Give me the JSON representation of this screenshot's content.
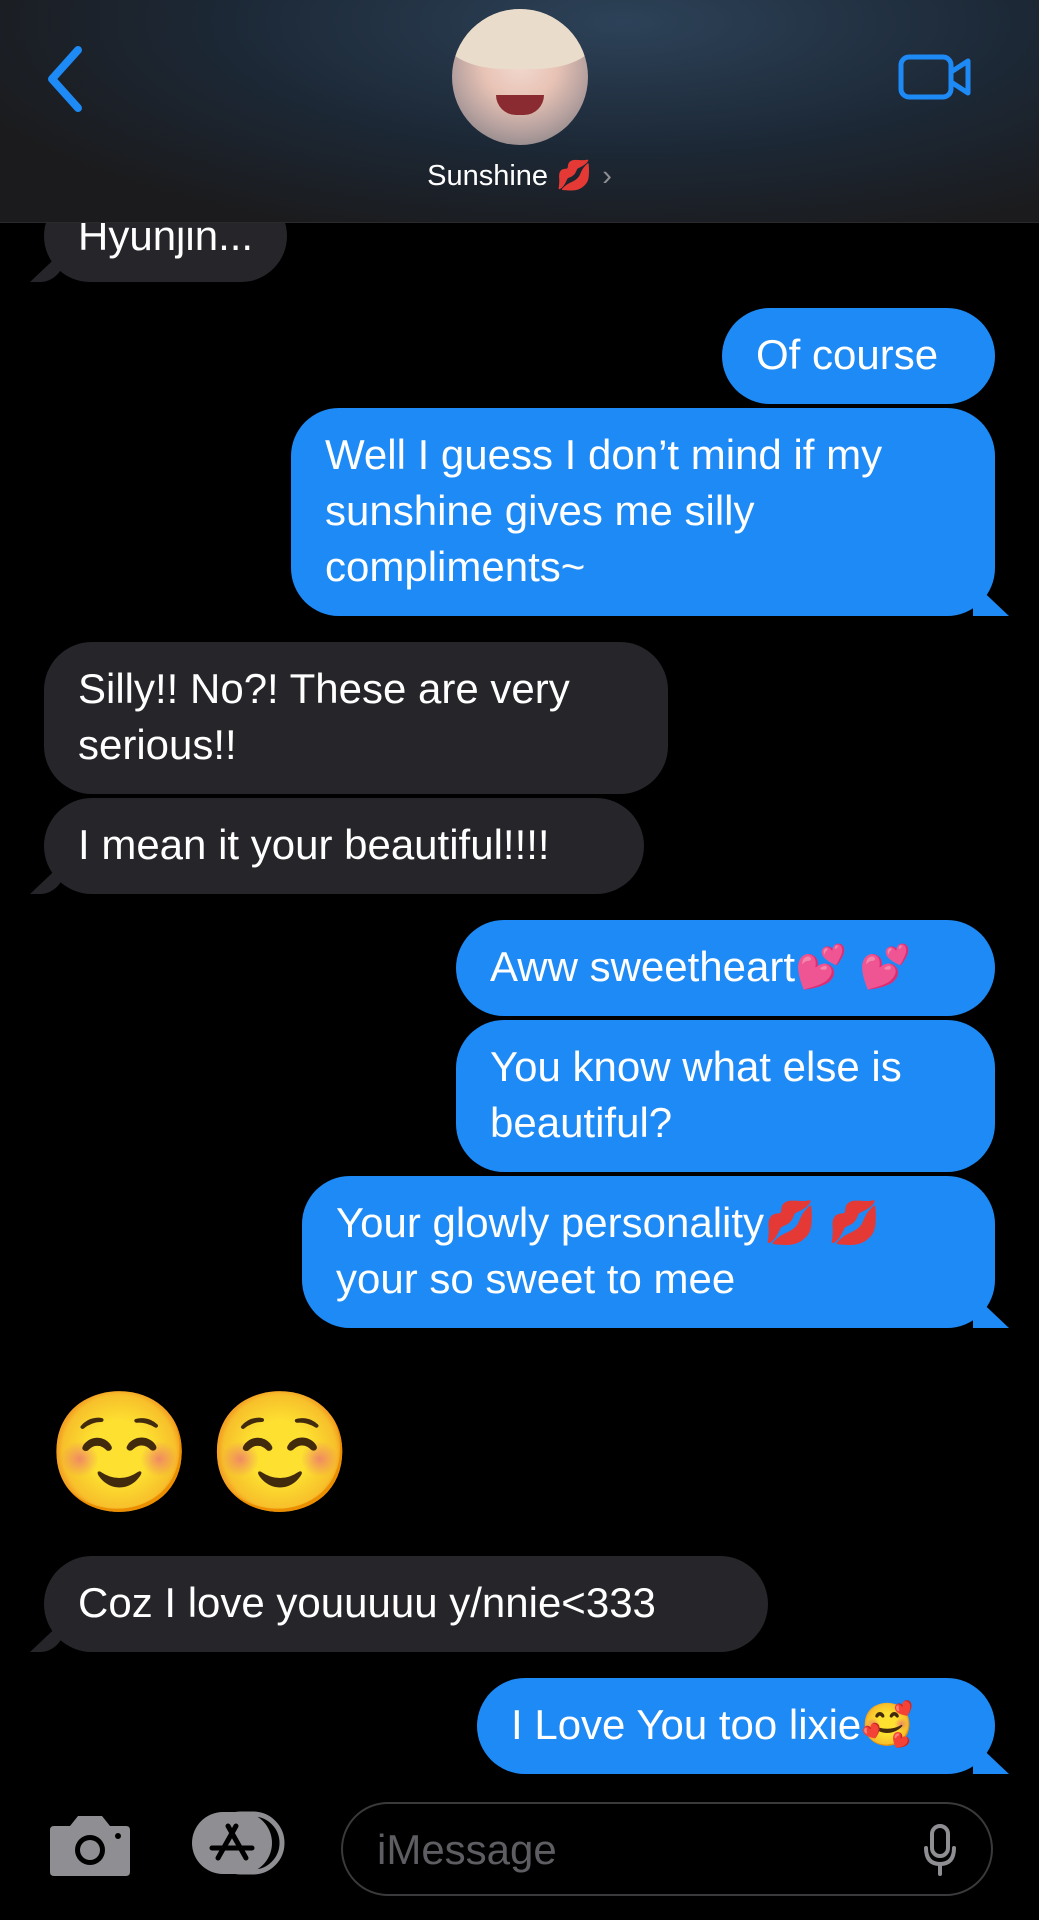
{
  "header": {
    "contact_name": "Sunshine 💋",
    "chevron": "›",
    "back_icon": "chevron-left-icon",
    "video_icon": "video-camera-icon"
  },
  "messages": [
    {
      "side": "in",
      "text": "Hyunjin..."
    },
    {
      "side": "out",
      "text": "Of course"
    },
    {
      "side": "out",
      "text": "Well I guess I don’t mind if my sunshine gives me silly compliments~"
    },
    {
      "side": "in",
      "text": "Silly!! No?! These are very serious!!"
    },
    {
      "side": "in",
      "text": "I mean it your beautiful!!!!"
    },
    {
      "side": "out",
      "text": "Aww sweetheart💕 💕"
    },
    {
      "side": "out",
      "text": "You know what else is beautiful?"
    },
    {
      "side": "out",
      "text": "Your glowly personality💋 💋 your so sweet to mee"
    },
    {
      "side": "in",
      "text": "☺️☺️"
    },
    {
      "side": "in",
      "text": "Coz I love youuuuu y/nnie<333"
    },
    {
      "side": "out",
      "text": "I Love You too lixie🥰"
    }
  ],
  "input": {
    "placeholder": "iMessage"
  },
  "colors": {
    "outgoing": "#1d8af5",
    "incoming": "#26252a",
    "accent": "#1d8af5"
  }
}
